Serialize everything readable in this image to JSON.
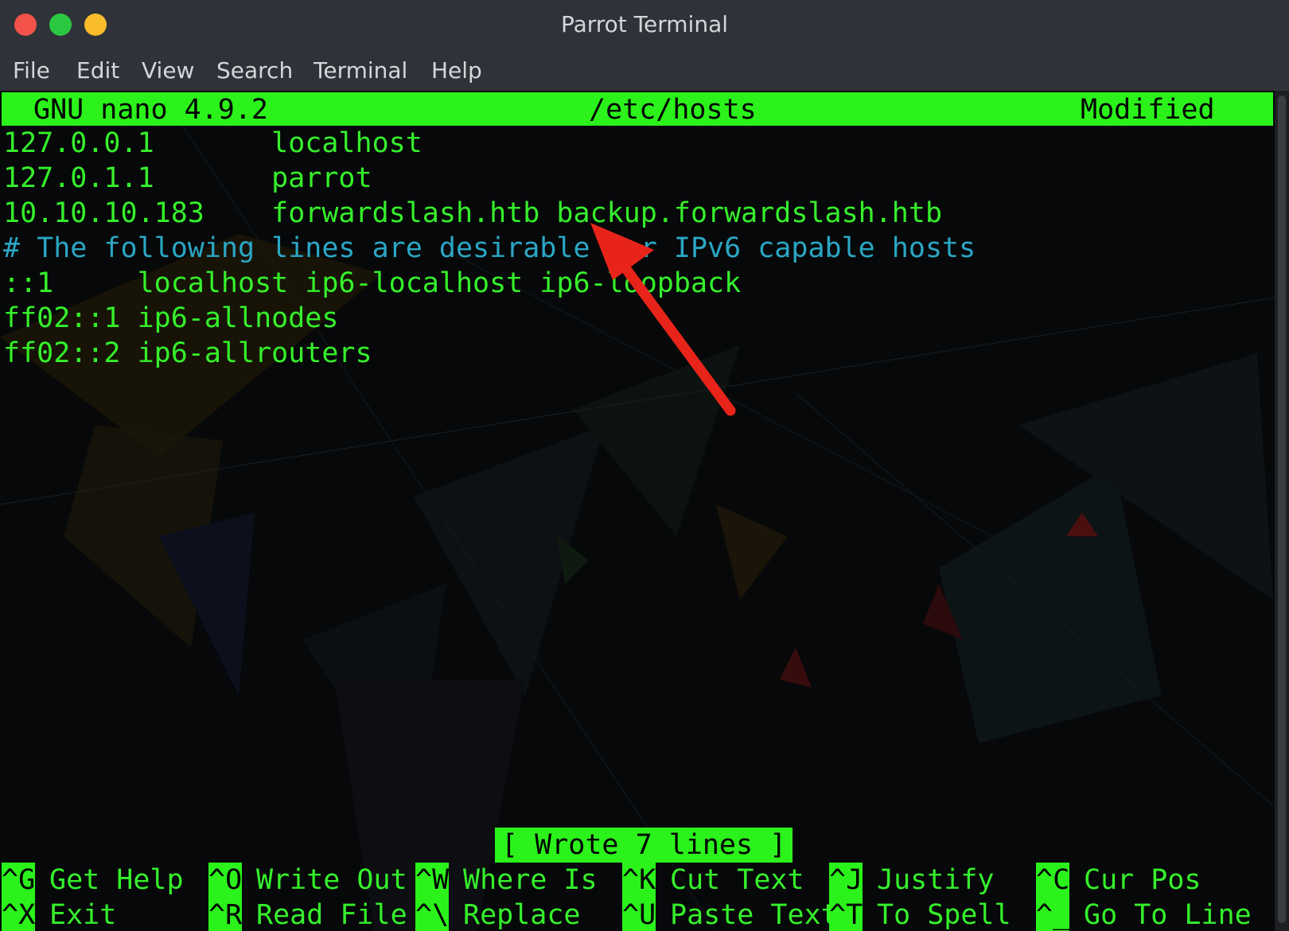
{
  "window": {
    "title": "Parrot Terminal",
    "menu": [
      "File",
      "Edit",
      "View",
      "Search",
      "Terminal",
      "Help"
    ]
  },
  "nano": {
    "version": "GNU nano 4.9.2",
    "filename": "/etc/hosts",
    "state": "Modified",
    "lines": [
      "127.0.0.1       localhost",
      "127.0.1.1       parrot",
      "10.10.10.183    forwardslash.htb backup.forwardslash.htb",
      "# The following lines are desirable for IPv6 capable hosts",
      "::1     localhost ip6-localhost ip6-loopback",
      "ff02::1 ip6-allnodes",
      "ff02::2 ip6-allrouters"
    ],
    "status_message": "[ Wrote 7 lines ]",
    "shortcuts_row1": [
      {
        "key": "^G",
        "label": "Get Help"
      },
      {
        "key": "^O",
        "label": "Write Out"
      },
      {
        "key": "^W",
        "label": "Where Is"
      },
      {
        "key": "^K",
        "label": "Cut Text"
      },
      {
        "key": "^J",
        "label": "Justify"
      },
      {
        "key": "^C",
        "label": "Cur Pos"
      }
    ],
    "shortcuts_row2": [
      {
        "key": "^X",
        "label": "Exit"
      },
      {
        "key": "^R",
        "label": "Read File"
      },
      {
        "key": "^\\",
        "label": "Replace"
      },
      {
        "key": "^U",
        "label": "Paste Text"
      },
      {
        "key": "^T",
        "label": "To Spell"
      },
      {
        "key": "^_",
        "label": "Go To Line"
      }
    ]
  },
  "colors": {
    "nano_green": "#2bf21b",
    "text_green": "#35f02b",
    "comment_blue": "#2ba6c4",
    "arrow_red": "#e8241a"
  }
}
